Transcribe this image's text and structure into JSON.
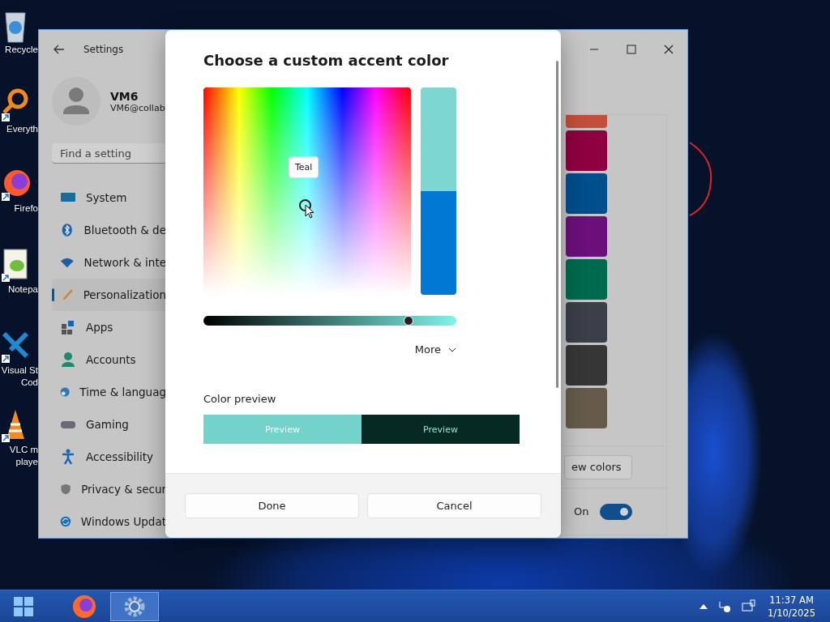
{
  "desktop_icons": [
    {
      "kind": "recycle",
      "lines": [
        "Recycle"
      ]
    },
    {
      "kind": "search",
      "lines": [
        "Everyth"
      ]
    },
    {
      "kind": "firefox",
      "lines": [
        "Firefo"
      ]
    },
    {
      "kind": "notepad",
      "lines": [
        "Notepa"
      ]
    },
    {
      "kind": "vscode",
      "lines": [
        "Visual St",
        "Cod"
      ]
    },
    {
      "kind": "vlc",
      "lines": [
        "VLC m",
        "playe"
      ]
    }
  ],
  "settings": {
    "title": "Settings",
    "user": {
      "name": "VM6",
      "email": "VM6@collab"
    },
    "search": {
      "placeholder": "Find a setting"
    },
    "nav": [
      {
        "kind": "system",
        "label": "System",
        "selected": false
      },
      {
        "kind": "bluetooth",
        "label": "Bluetooth & de",
        "selected": false
      },
      {
        "kind": "network",
        "label": "Network & inte",
        "selected": false
      },
      {
        "kind": "personalization",
        "label": "Personalization",
        "selected": true
      },
      {
        "kind": "apps",
        "label": "Apps",
        "selected": false
      },
      {
        "kind": "accounts",
        "label": "Accounts",
        "selected": false
      },
      {
        "kind": "time",
        "label": "Time & languag",
        "selected": false
      },
      {
        "kind": "gaming",
        "label": "Gaming",
        "selected": false
      },
      {
        "kind": "accessibility",
        "label": "Accessibility",
        "selected": false
      },
      {
        "kind": "privacy",
        "label": "Privacy & secur",
        "selected": false
      },
      {
        "kind": "update",
        "label": "Windows Updat",
        "selected": false
      }
    ],
    "accent_swatches": [
      {
        "color": "#c24f3a"
      },
      {
        "color": "#8e0040"
      },
      {
        "color": "#004e8c"
      },
      {
        "color": "#6b0f7a"
      },
      {
        "color": "#006a4e"
      },
      {
        "color": "#3b3f4a"
      },
      {
        "color": "#363636"
      },
      {
        "color": "#665b4b"
      }
    ],
    "view_colors_button": "ew colors",
    "transparency": {
      "label": "On",
      "on": true
    }
  },
  "dialog": {
    "title": "Choose a custom accent color",
    "tooltip": "Teal",
    "slider": {
      "level": 0.81
    },
    "more": "More",
    "preview_label": "Color preview",
    "preview_tiles": [
      {
        "kind": "light",
        "label": "Preview"
      },
      {
        "kind": "dark",
        "label": "Preview"
      }
    ],
    "buttons": [
      "Done",
      "Cancel"
    ]
  },
  "taskbar": {
    "apps": [
      {
        "kind": "firefox",
        "selected": false
      },
      {
        "kind": "settings",
        "selected": true
      }
    ],
    "time": "11:37 AM",
    "date": "1/10/2025"
  }
}
